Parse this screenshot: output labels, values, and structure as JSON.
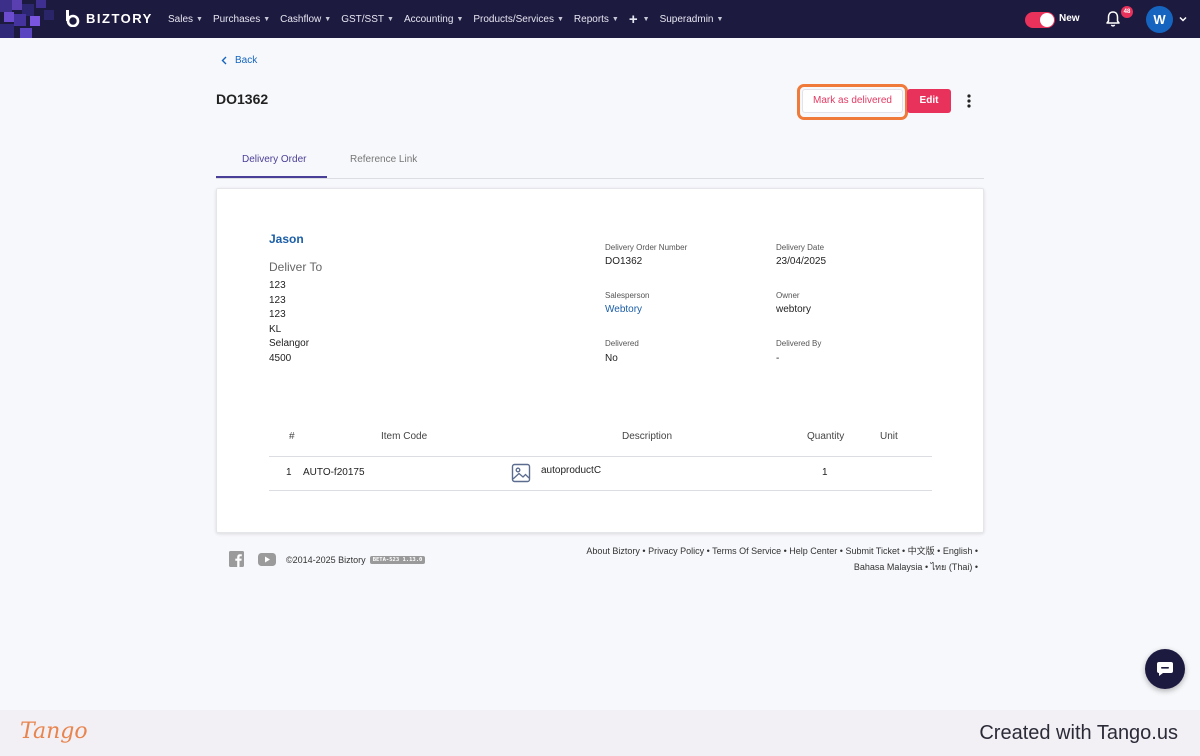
{
  "nav": {
    "brand": "BIZTORY",
    "items": [
      {
        "label": "Sales"
      },
      {
        "label": "Purchases"
      },
      {
        "label": "Cashflow"
      },
      {
        "label": "GST/SST"
      },
      {
        "label": "Accounting"
      },
      {
        "label": "Products/Services"
      },
      {
        "label": "Reports"
      },
      {
        "label": "+"
      },
      {
        "label": "Superadmin"
      }
    ],
    "toggle_label": "New",
    "notification_count": "48",
    "avatar_initial": "W"
  },
  "colors": {
    "nav_bg": "#1d1a3f",
    "accent": "#e9325b",
    "link": "#1b5ea8",
    "tab_active": "#4a3f98",
    "highlight": "#f07a3a"
  },
  "header": {
    "back_label": "Back",
    "title": "DO1362",
    "mark_delivered_label": "Mark as delivered",
    "edit_label": "Edit"
  },
  "tabs": [
    {
      "label": "Delivery Order",
      "active": true
    },
    {
      "label": "Reference Link",
      "active": false
    }
  ],
  "order": {
    "customer": "Jason",
    "deliver_to_label": "Deliver To",
    "address": [
      "123",
      "123",
      "123",
      "KL",
      "Selangor",
      "4500"
    ],
    "fields": {
      "do_number": {
        "label": "Delivery Order Number",
        "value": "DO1362"
      },
      "delivery_date": {
        "label": "Delivery Date",
        "value": "23/04/2025"
      },
      "salesperson": {
        "label": "Salesperson",
        "value": "Webtory"
      },
      "owner": {
        "label": "Owner",
        "value": "webtory"
      },
      "delivered": {
        "label": "Delivered",
        "value": "No"
      },
      "delivered_by": {
        "label": "Delivered By",
        "value": "-"
      }
    }
  },
  "items_table": {
    "columns": [
      "#",
      "Item Code",
      "Description",
      "Quantity",
      "Unit"
    ],
    "rows": [
      {
        "index": "1",
        "item_code": "AUTO-f20175",
        "description": "autoproductC",
        "quantity": "1",
        "unit": ""
      }
    ]
  },
  "footer": {
    "copyright": "©2014-2025 Biztory",
    "version_badge": "BETA-523 1.13.0",
    "links": [
      "About Biztory",
      "Privacy Policy",
      "Terms Of Service",
      "Help Center",
      "Submit Ticket",
      "中文版",
      "English",
      "Bahasa Malaysia",
      "ไทย (Thai)"
    ]
  },
  "watermark": {
    "logo": "Tango",
    "created": "Created with Tango.us"
  }
}
